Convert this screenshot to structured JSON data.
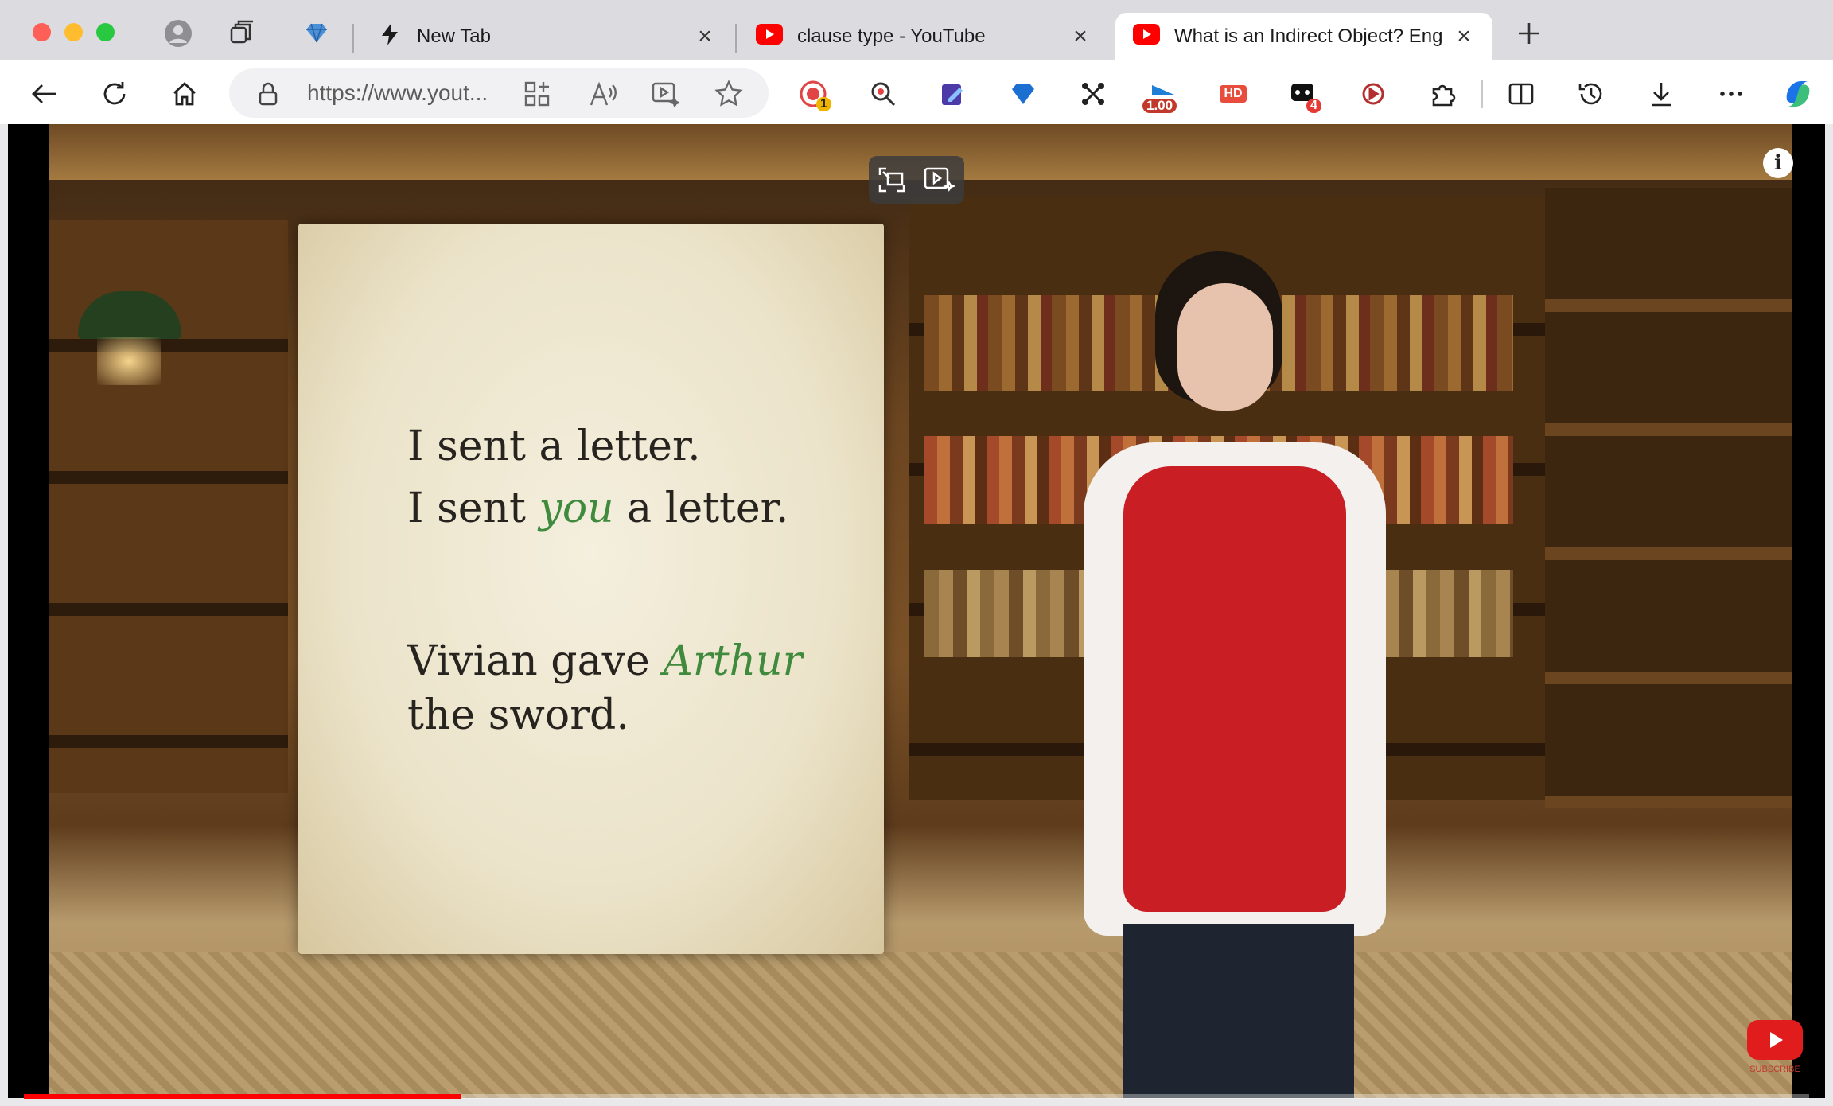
{
  "tabs": [
    {
      "title": "New Tab",
      "icon": "lightning-icon",
      "active": false
    },
    {
      "title": "clause type - YouTube",
      "icon": "youtube-icon",
      "active": false
    },
    {
      "title": "What is an Indirect Object? Eng",
      "icon": "youtube-icon",
      "active": true
    }
  ],
  "toolbar": {
    "url": "https://www.yout...",
    "extensions": [
      {
        "name": "record-extension-icon",
        "badge": "1"
      },
      {
        "name": "zoom-search-extension-icon"
      },
      {
        "name": "note-extension-icon"
      },
      {
        "name": "diamond-extension-icon"
      },
      {
        "name": "connect-extension-icon"
      },
      {
        "name": "speed-extension-icon",
        "badge": "1.00"
      },
      {
        "name": "hd-extension-icon",
        "label": "HD"
      },
      {
        "name": "chat-extension-icon",
        "badge": "4"
      },
      {
        "name": "sync-extension-icon"
      }
    ]
  },
  "video": {
    "slide_lines": {
      "line1": "I sent a letter.",
      "line2_before": "I sent ",
      "line2_highlight": "you",
      "line2_after": " a letter.",
      "line3_before": "Vivian gave ",
      "line3_highlight": "Arthur",
      "line4": "the sword."
    },
    "subscribe_label": "SUBSCRIBE",
    "info_icon": "i",
    "progress": 0.245
  },
  "colors": {
    "accent_red": "#ff0000",
    "highlight_green": "#3f8a3c",
    "copilot_blue": "#1a74e8"
  }
}
